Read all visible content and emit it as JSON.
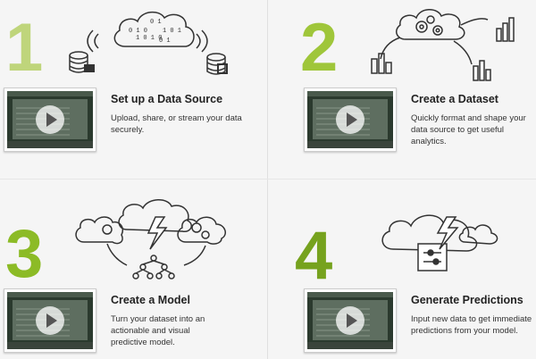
{
  "colors": {
    "light_green": "#b6d06a",
    "mid_green": "#8fbb2c",
    "dark_green": "#76a21e"
  },
  "steps": [
    {
      "number": "1",
      "title": "Set up a Data Source",
      "description": "Upload, share, or stream your data securely."
    },
    {
      "number": "2",
      "title": "Create a Dataset",
      "description": "Quickly format and shape your data source to get useful analytics."
    },
    {
      "number": "3",
      "title": "Create a Model",
      "description": "Turn your dataset into an actionable and visual predictive model."
    },
    {
      "number": "4",
      "title": "Generate Predictions",
      "description": "Input new data to get immediate predictions from your model."
    }
  ],
  "icons": [
    "cloud-binary-icon",
    "database-icon",
    "cloud-gears-icon",
    "bar-chart-icon",
    "lightning-icon",
    "tree-model-icon",
    "prediction-box-icon",
    "play-icon"
  ]
}
